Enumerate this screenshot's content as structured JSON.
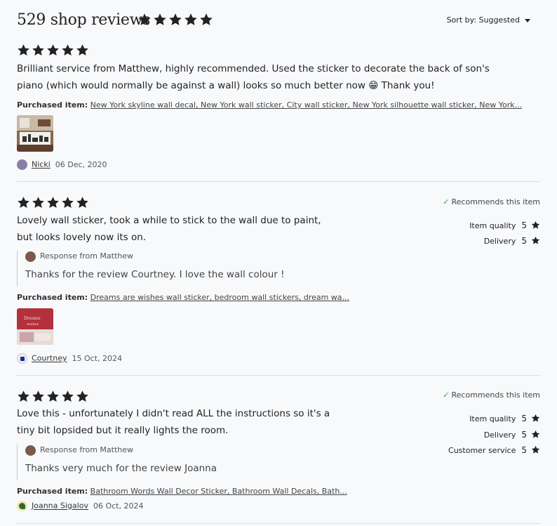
{
  "header": {
    "title": "529 shop reviews",
    "sort_label": "Sort by: Suggested",
    "rating": 5
  },
  "reviews": [
    {
      "stars": 5,
      "text_lines": [
        "Brilliant service from Matthew, highly recommended. Used the sticker to decorate the back of son's",
        "piano (which would normally be against a wall) looks so much better now 😁 Thank you!"
      ],
      "purchased_label": "Purchased item:",
      "purchased_item": "New York skyline wall decal, New York wall sticker, City wall sticker, New York silhouette wall sticker, New York...",
      "user": "Nicki",
      "date": "06 Dec, 2020"
    },
    {
      "stars": 5,
      "recommends": "Recommends this item",
      "ratings": [
        {
          "label": "Item quality",
          "value": "5"
        },
        {
          "label": "Delivery",
          "value": "5"
        }
      ],
      "text_lines": [
        "Lovely wall sticker, took a while to stick to the wall due to paint,",
        "but looks lovely now its on."
      ],
      "response_from": "Response from Matthew",
      "response_text": "Thanks for the review Courtney. I love the wall colour !",
      "purchased_label": "Purchased item:",
      "purchased_item": "Dreams are wishes wall sticker, bedroom wall stickers, dream wa...",
      "user": "Courtney",
      "date": "15 Oct, 2024"
    },
    {
      "stars": 5,
      "recommends": "Recommends this item",
      "ratings": [
        {
          "label": "Item quality",
          "value": "5"
        },
        {
          "label": "Delivery",
          "value": "5"
        },
        {
          "label": "Customer service",
          "value": "5"
        }
      ],
      "text_lines": [
        "Love this - unfortunately I didn't read ALL the instructions so it's a",
        "tiny bit lopsided but it really lights the room."
      ],
      "response_from": "Response from Matthew",
      "response_text": "Thanks very much for the review Joanna",
      "purchased_label": "Purchased item:",
      "purchased_item": "Bathroom Words Wall Decor Sticker, Bathroom Wall Decals, Bath...",
      "user": "Joanna Sigalov",
      "date": "06 Oct, 2024"
    }
  ],
  "colors": {
    "background": "#f8f9fb",
    "star": "#222222",
    "check": "#3a9d5d",
    "divider": "#dcdde0"
  },
  "icons": [
    "star-icon",
    "check-icon",
    "chevron-down-icon",
    "avatar"
  ]
}
